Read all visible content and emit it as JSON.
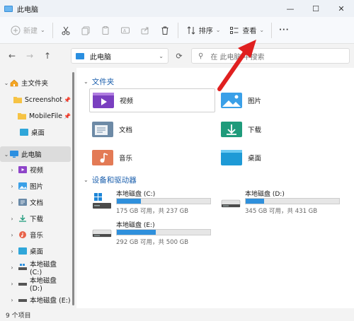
{
  "window": {
    "title": "此电脑",
    "controls": [
      "—",
      "☐",
      "✕"
    ]
  },
  "toolbar": {
    "new_label": "新建",
    "sort_label": "排序",
    "view_label": "查看",
    "more_label": "···"
  },
  "address": {
    "path": "此电脑"
  },
  "search": {
    "placeholder": "在 此电脑 中搜索"
  },
  "sidebar": {
    "items": [
      {
        "label": "主文件夹",
        "icon": "home-icon"
      },
      {
        "label": "Screenshot",
        "icon": "folder-icon"
      },
      {
        "label": "MobileFile",
        "icon": "folder-icon"
      },
      {
        "label": "桌面",
        "icon": "desktop-icon"
      },
      {
        "label": "此电脑",
        "icon": "pc-icon"
      },
      {
        "label": "视频",
        "icon": "videos-icon"
      },
      {
        "label": "图片",
        "icon": "pictures-icon"
      },
      {
        "label": "文档",
        "icon": "documents-icon"
      },
      {
        "label": "下载",
        "icon": "downloads-icon"
      },
      {
        "label": "音乐",
        "icon": "music-icon"
      },
      {
        "label": "桌面",
        "icon": "desktop-icon"
      },
      {
        "label": "本地磁盘 (C:)",
        "icon": "drive-icon"
      },
      {
        "label": "本地磁盘 (D:)",
        "icon": "drive-icon"
      },
      {
        "label": "本地磁盘 (E:)",
        "icon": "drive-icon"
      }
    ]
  },
  "main": {
    "folders_heading": "文件夹",
    "folders": [
      {
        "label": "视频",
        "icon": "videos-icon"
      },
      {
        "label": "图片",
        "icon": "pictures-icon"
      },
      {
        "label": "文档",
        "icon": "documents-icon"
      },
      {
        "label": "下载",
        "icon": "downloads-icon"
      },
      {
        "label": "音乐",
        "icon": "music-icon"
      },
      {
        "label": "桌面",
        "icon": "desktop-icon"
      }
    ],
    "drives_heading": "设备和驱动器",
    "drives": [
      {
        "name": "本地磁盘 (C:)",
        "free": "175 GB 可用，共 237 GB",
        "used_fraction": 0.26
      },
      {
        "name": "本地磁盘 (D:)",
        "free": "345 GB 可用，共 431 GB",
        "used_fraction": 0.2
      },
      {
        "name": "本地磁盘 (E:)",
        "free": "292 GB 可用，共 500 GB",
        "used_fraction": 0.42
      }
    ]
  },
  "status": {
    "count": "9 个项目"
  },
  "colors": {
    "accent": "#2f90dc",
    "annotation": "#e02020",
    "heading": "#1b5fad"
  }
}
